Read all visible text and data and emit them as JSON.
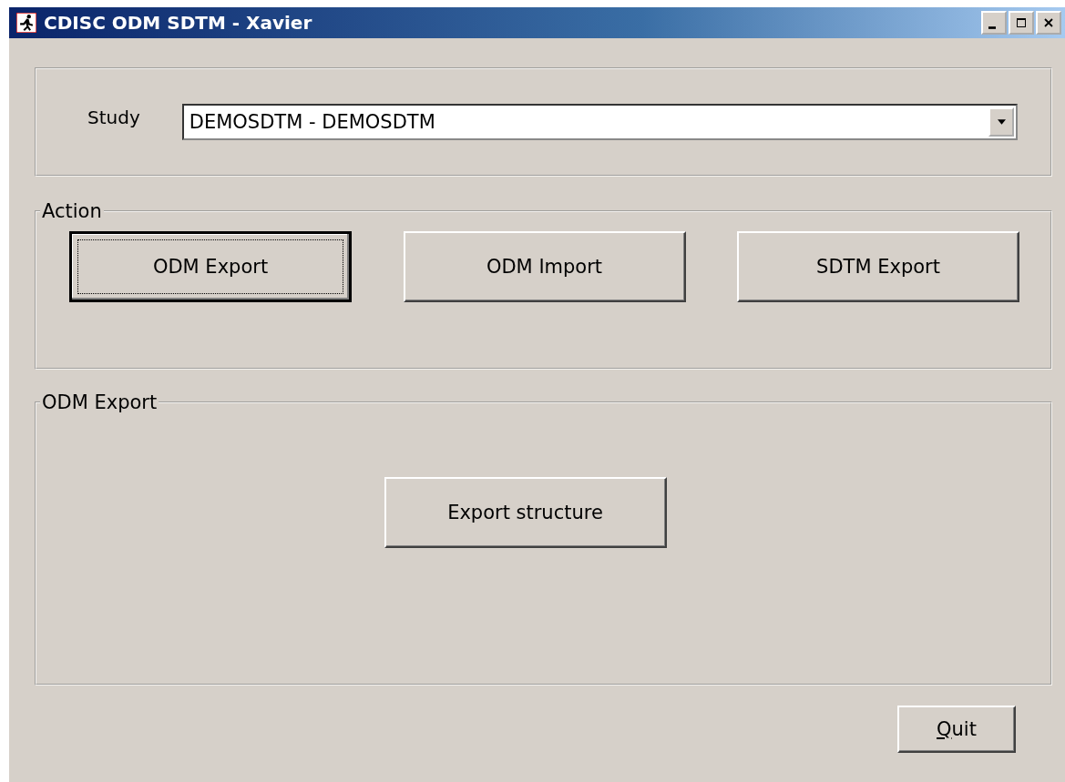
{
  "window": {
    "title": "CDISC ODM SDTM - Xavier",
    "controls": [
      {
        "kind": "minimize"
      },
      {
        "kind": "maximize"
      },
      {
        "kind": "close"
      }
    ]
  },
  "study": {
    "label": "Study",
    "value": "DEMOSDTM - DEMOSDTM"
  },
  "action_group": {
    "title": "Action",
    "buttons": [
      {
        "label": "ODM Export",
        "focused": true
      },
      {
        "label": "ODM Import",
        "focused": false
      },
      {
        "label": "SDTM Export",
        "focused": false
      }
    ]
  },
  "export_group": {
    "title": "ODM Export",
    "buttons": [
      {
        "label": "Export structure",
        "focused": false
      }
    ]
  },
  "quit_button": {
    "label": "Quit",
    "first_letter_underlined": true
  }
}
